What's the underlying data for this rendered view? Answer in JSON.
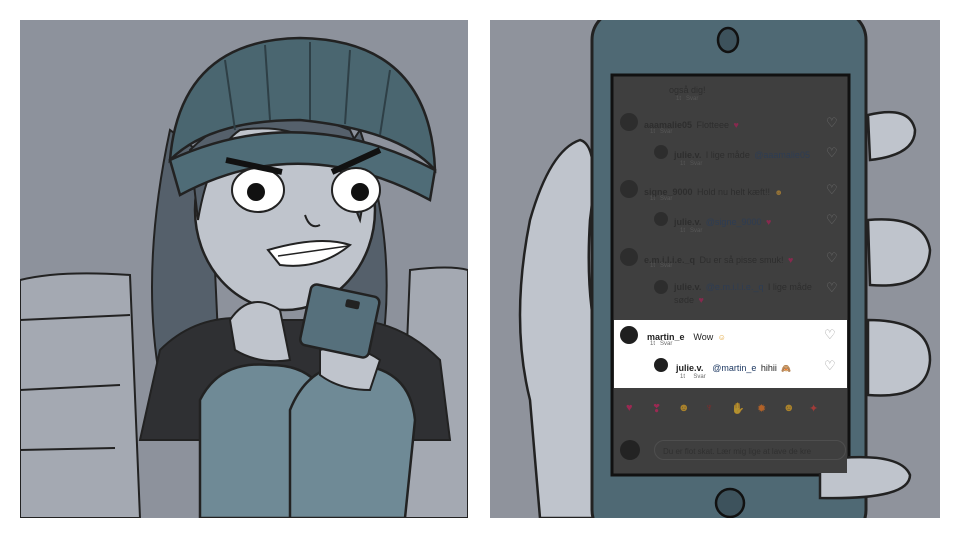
{
  "colors": {
    "background": "#8d929c",
    "phone_body": "#4f6974",
    "screen_dim": "#3f3f3f",
    "highlight": "#ffffff",
    "heart": "#c2185b"
  },
  "comments": [
    {
      "text_tail": "også dig!",
      "meta": [
        "1t",
        "Svar"
      ]
    },
    {
      "user": "aaamalie05",
      "text": "Flotteee",
      "emoji": "red-heart",
      "meta": [
        "1t",
        "Svar"
      ]
    },
    {
      "user": "julie.v.",
      "mention": "@aaamalie05",
      "text": "I lige måde",
      "meta": [
        "1t",
        "Svar"
      ],
      "reply": true
    },
    {
      "user": "signe_9000",
      "text": "Hold nu helt kæft!!",
      "emoji": "heart-eyes",
      "meta": [
        "1t",
        "Svar"
      ]
    },
    {
      "user": "julie.v.",
      "mention": "@signe_9000",
      "emoji": "red-heart",
      "meta": [
        "1t",
        "Svar"
      ],
      "reply": true
    },
    {
      "user": "e.m.i.l.i.e._q",
      "text": "Du er så pisse smuk!",
      "emoji": "red-heart",
      "meta": [
        "1t",
        "Svar"
      ]
    },
    {
      "user": "julie.v.",
      "mention": "@e.m.i.l.i.e._q",
      "text": "I lige måde",
      "text2": "søde",
      "emoji": "red-heart",
      "meta": [
        "1t",
        "Svar"
      ],
      "reply": true
    }
  ],
  "highlighted": [
    {
      "user": "martin_e",
      "text": "Wow",
      "emoji": "blush",
      "meta": [
        "1t",
        "Svar"
      ]
    },
    {
      "user": "julie.v.",
      "mention": "@martin_e",
      "text": "hihii",
      "emoji": "see-no-evil",
      "meta": [
        "1t",
        "Svar"
      ]
    }
  ],
  "emoji_bar": [
    "red-heart-icon",
    "two-hearts-icon",
    "laugh-icon",
    "wine-icon",
    "clap-icon",
    "fire-icon",
    "cool-icon",
    "party-icon"
  ],
  "comment_input": {
    "value": "Du er flot skat. Lær mig lige at lave de kre"
  }
}
